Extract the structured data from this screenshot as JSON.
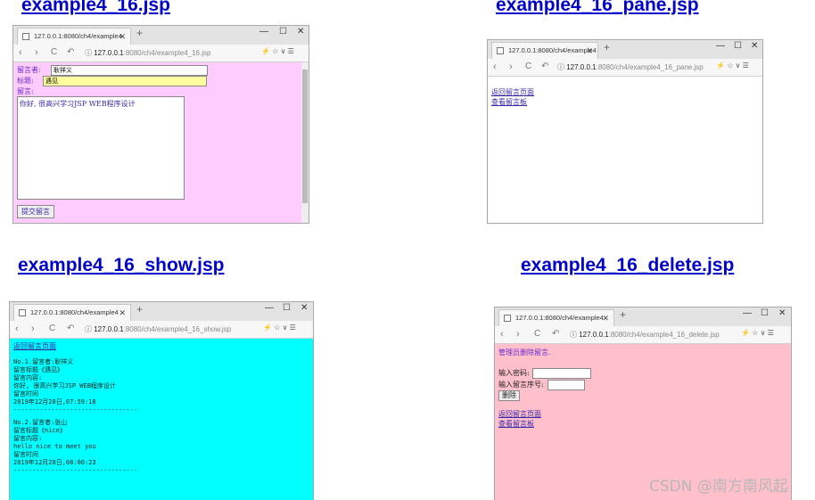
{
  "headings": {
    "topleft": "example4_16.jsp",
    "topright": "example4_16_pane.jsp",
    "bottomleft": "example4_16_show.jsp",
    "bottomright": "example4_16_delete.jsp"
  },
  "browser": {
    "tab_title": "127.0.0.1:8080/ch4/example4",
    "host": "127.0.0.1",
    "new_tab": "+",
    "minimize": "—",
    "maximize": "☐",
    "close": "✕",
    "back": "‹",
    "forward": "›",
    "reload": "C",
    "undo": "↶",
    "info": "ⓘ",
    "tools": "⚡ ☆ ∨ ☰"
  },
  "win1": {
    "path": ":8080/ch4/example4_16.jsp",
    "name_label": "留言者:",
    "name_value": "耿祥义",
    "title_label": "标题:",
    "title_value": "遇见",
    "message_label": "留言:",
    "message_value": "你好, 很高兴学习JSP WEB程序设计",
    "submit_label": "提交留言"
  },
  "win2": {
    "path": ":8080/ch4/example4_16_pane.jsp",
    "link_back": "返回留言页面",
    "link_view": "查看留言板"
  },
  "win3": {
    "path": ":8080/ch4/example4_16_show.jsp",
    "link_back": "返回留言页面",
    "entries": [
      [
        "No.1.留言者:耿祥义",
        "留言标题《遇见》",
        "留言内容:",
        "你好, 很高兴学习JSP WEB程序设计",
        "留言时间",
        "2019年12月28日,07:59:18",
        "---------------------------------"
      ],
      [
        "No.2.留言者:张山",
        "留言标题《nice》",
        "留言内容:",
        "hello nice to meet you",
        "留言时间",
        "2019年12月28日,08:00:23",
        "---------------------------------"
      ]
    ]
  },
  "win4": {
    "path": ":8080/ch4/example4_16_delete.jsp",
    "admin_text": "管理员删除留言.",
    "password_label": "输入密码:",
    "serial_label": "输入留言序号:",
    "delete_label": "删除",
    "link_back": "返回留言页面",
    "link_view": "查看留言板"
  },
  "watermark": "CSDN @南方南风起"
}
